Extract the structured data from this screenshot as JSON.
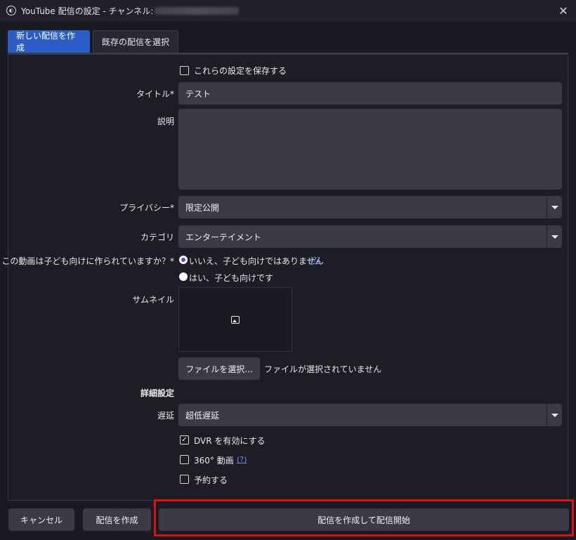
{
  "window": {
    "title": "YouTube 配信の設定 - チャンネル:",
    "close_glyph": "✕"
  },
  "tabs": [
    {
      "label": "新しい配信を作成",
      "active": true
    },
    {
      "label": "既存の配信を選択",
      "active": false
    }
  ],
  "form": {
    "save_settings": {
      "label": "これらの設定を保存する",
      "checked": false
    },
    "title": {
      "label": "タイトル*",
      "value": "テスト"
    },
    "description": {
      "label": "説明",
      "value": ""
    },
    "privacy": {
      "label": "プライバシー*",
      "value": "限定公開"
    },
    "category": {
      "label": "カテゴリ",
      "value": "エンターテイメント"
    },
    "kids": {
      "label": "この動画は子ども向けに作られていますか？*",
      "options": [
        {
          "label": "いいえ、子ども向けではありません",
          "selected": true
        },
        {
          "label": "はい、子ども向けです",
          "selected": false
        }
      ],
      "help": "(?)"
    },
    "thumbnail": {
      "label": "サムネイル",
      "choose_button": "ファイルを選択...",
      "status": "ファイルが選択されていません"
    },
    "advanced_heading": "詳細設定",
    "latency": {
      "label": "遅延",
      "value": "超低遅延"
    },
    "dvr": {
      "label": "DVR を有効にする",
      "checked": true
    },
    "vr360": {
      "label": "360° 動画",
      "checked": false,
      "help": "(?)"
    },
    "schedule": {
      "label": "予約する",
      "checked": false
    }
  },
  "footer": {
    "cancel": "キャンセル",
    "create": "配信を作成",
    "create_and_start": "配信を作成して配信開始"
  },
  "colors": {
    "accent": "#2c5cc5",
    "highlight": "#e01010",
    "background": "#1a1a22",
    "field": "#3a3b47"
  }
}
